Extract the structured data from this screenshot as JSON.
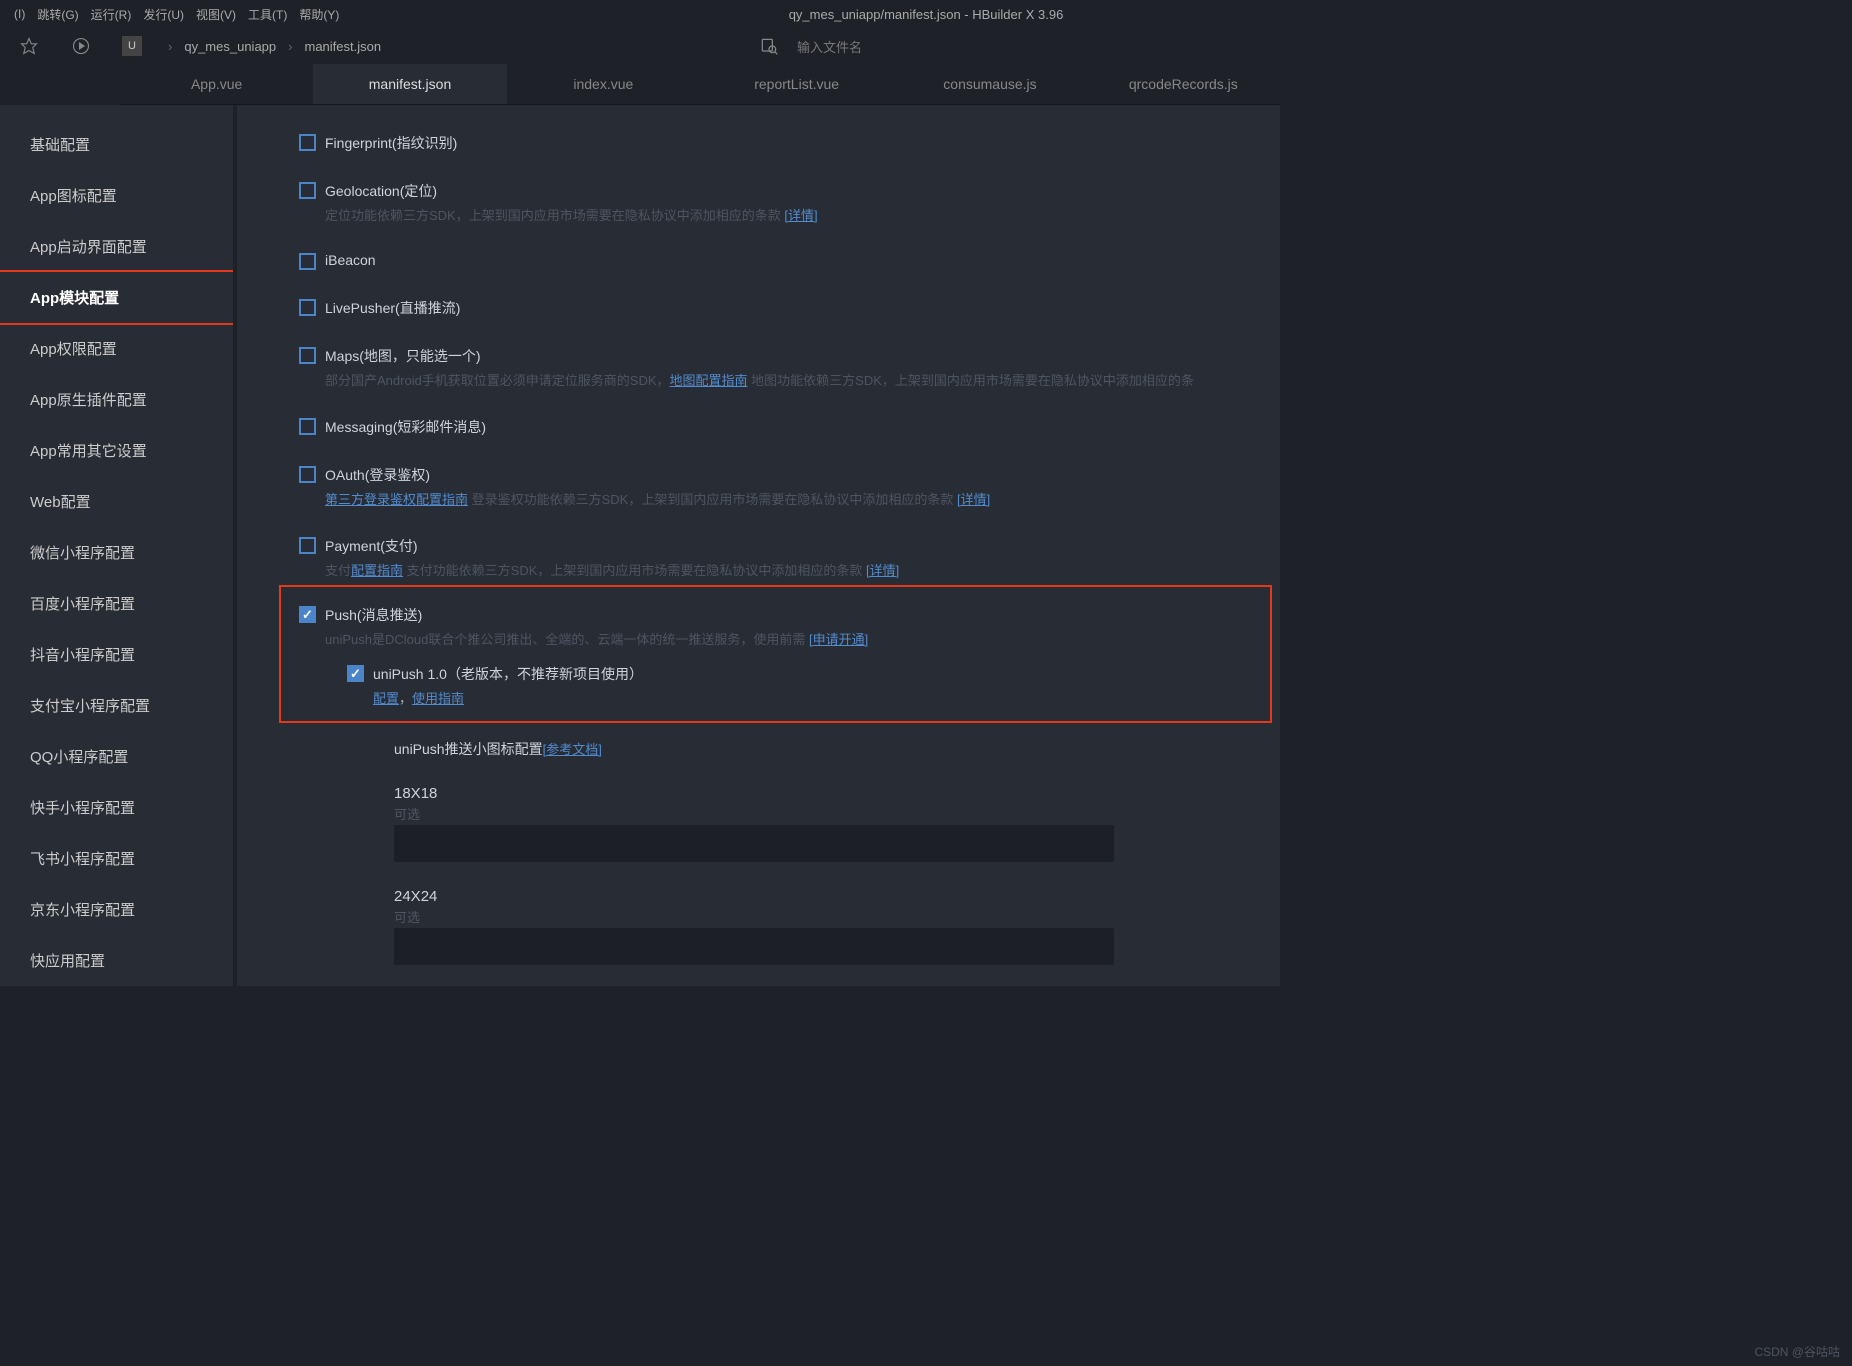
{
  "menubar": {
    "items": [
      "(I)",
      "跳转(G)",
      "运行(R)",
      "发行(U)",
      "视图(V)",
      "工具(T)",
      "帮助(Y)"
    ]
  },
  "window_title": "qy_mes_uniapp/manifest.json - HBuilder X 3.96",
  "breadcrumb": {
    "project": "qy_mes_uniapp",
    "file": "manifest.json"
  },
  "search": {
    "placeholder": "输入文件名"
  },
  "tabs": [
    {
      "label": "App.vue",
      "active": false
    },
    {
      "label": "manifest.json",
      "active": true
    },
    {
      "label": "index.vue",
      "active": false
    },
    {
      "label": "reportList.vue",
      "active": false
    },
    {
      "label": "consumause.js",
      "active": false
    },
    {
      "label": "qrcodeRecords.js",
      "active": false
    }
  ],
  "sidebar": {
    "items": [
      {
        "label": "基础配置",
        "active": false
      },
      {
        "label": "App图标配置",
        "active": false
      },
      {
        "label": "App启动界面配置",
        "active": false
      },
      {
        "label": "App模块配置",
        "active": true,
        "highlight": true
      },
      {
        "label": "App权限配置",
        "active": false
      },
      {
        "label": "App原生插件配置",
        "active": false
      },
      {
        "label": "App常用其它设置",
        "active": false
      },
      {
        "label": "Web配置",
        "active": false
      },
      {
        "label": "微信小程序配置",
        "active": false
      },
      {
        "label": "百度小程序配置",
        "active": false
      },
      {
        "label": "抖音小程序配置",
        "active": false
      },
      {
        "label": "支付宝小程序配置",
        "active": false
      },
      {
        "label": "QQ小程序配置",
        "active": false
      },
      {
        "label": "快手小程序配置",
        "active": false
      },
      {
        "label": "飞书小程序配置",
        "active": false
      },
      {
        "label": "京东小程序配置",
        "active": false
      },
      {
        "label": "快应用配置",
        "active": false
      }
    ]
  },
  "modules": {
    "fingerprint": {
      "label": "Fingerprint(指纹识别)"
    },
    "geolocation": {
      "label": "Geolocation(定位)",
      "desc_pre": "定位功能依赖三方SDK，上架到国内应用市场需要在隐私协议中添加相应的条款 ",
      "desc_link": "[详情]"
    },
    "ibeacon": {
      "label": "iBeacon"
    },
    "livepusher": {
      "label": "LivePusher(直播推流)"
    },
    "maps": {
      "label": "Maps(地图，只能选一个)",
      "desc_pre": "部分国产Android手机获取位置必须申请定位服务商的SDK，",
      "desc_link1": "地图配置指南",
      "desc_mid": " 地图功能依赖三方SDK，上架到国内应用市场需要在隐私协议中添加相应的条"
    },
    "messaging": {
      "label": "Messaging(短彩邮件消息)"
    },
    "oauth": {
      "label": "OAuth(登录鉴权)",
      "desc_link1": "第三方登录鉴权配置指南",
      "desc_mid": " 登录鉴权功能依赖三方SDK，上架到国内应用市场需要在隐私协议中添加相应的条款 ",
      "desc_link2": "[详情]"
    },
    "payment": {
      "label": "Payment(支付)",
      "desc_pre": "支付",
      "desc_link1": "配置指南",
      "desc_mid": " 支付功能依赖三方SDK，上架到国内应用市场需要在隐私协议中添加相应的条款 ",
      "desc_link2": "[详情]"
    },
    "push": {
      "label": "Push(消息推送)",
      "desc_pre": "uniPush是DCloud联合个推公司推出、全端的、云端一体的统一推送服务，使用前需 ",
      "desc_link": "[申请开通]",
      "sub": {
        "label": "uniPush 1.0（老版本，不推荐新项目使用）",
        "link1": "配置",
        "sep": "，",
        "link2": "使用指南"
      }
    },
    "icon_section": {
      "title_pre": "uniPush推送小图标配置",
      "title_link": "[参考文档]",
      "s18": "18X18",
      "s24": "24X24",
      "optional": "可选"
    }
  },
  "watermark": "CSDN @谷咕咕"
}
